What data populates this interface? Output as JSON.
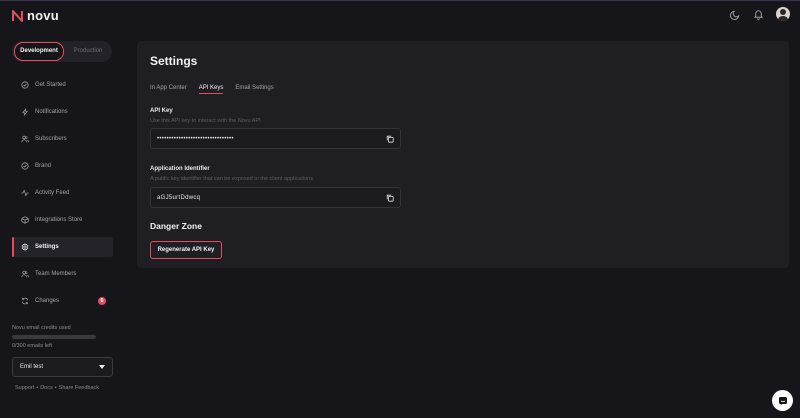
{
  "brand": {
    "name": "novu",
    "accent": "#e54d5f"
  },
  "header": {
    "icons": [
      "moon-icon",
      "bell-icon",
      "user-avatar"
    ]
  },
  "env_toggle": {
    "options": [
      "Development",
      "Production"
    ],
    "selected": "Development"
  },
  "sidebar": {
    "items": [
      {
        "label": "Get Started",
        "icon": "check-circle-icon"
      },
      {
        "label": "Notifications",
        "icon": "lightning-icon"
      },
      {
        "label": "Subscribers",
        "icon": "users-icon"
      },
      {
        "label": "Brand",
        "icon": "check-circle-icon"
      },
      {
        "label": "Activity Feed",
        "icon": "activity-icon"
      },
      {
        "label": "Integrations Store",
        "icon": "box-icon"
      },
      {
        "label": "Settings",
        "icon": "gear-icon",
        "active": true
      },
      {
        "label": "Team Members",
        "icon": "users-icon"
      },
      {
        "label": "Changes",
        "icon": "refresh-icon",
        "badge": "6"
      }
    ],
    "credits": {
      "title": "Novu email credits used",
      "used_fraction": 0.0,
      "left_text": "0/300 emails left"
    },
    "org_select": {
      "value": "Emil test"
    },
    "footer_links": [
      "Support",
      "•",
      "Docs",
      "•",
      "Share Feedback"
    ]
  },
  "main": {
    "title": "Settings",
    "tabs": [
      {
        "label": "In App Center"
      },
      {
        "label": "API Keys",
        "active": true
      },
      {
        "label": "Email Settings"
      }
    ],
    "api_key": {
      "label": "API Key",
      "help": "Use this API key to interact with the Novu API",
      "value": "••••••••••••••••••••••••••••••••"
    },
    "app_identifier": {
      "label": "Application Identifier",
      "help": "A public key identifier that can be exposed to the client applications",
      "value": "aGJ5urtDdwcq"
    },
    "danger_zone": {
      "title": "Danger Zone",
      "regenerate_label": "Regenerate API Key"
    }
  }
}
